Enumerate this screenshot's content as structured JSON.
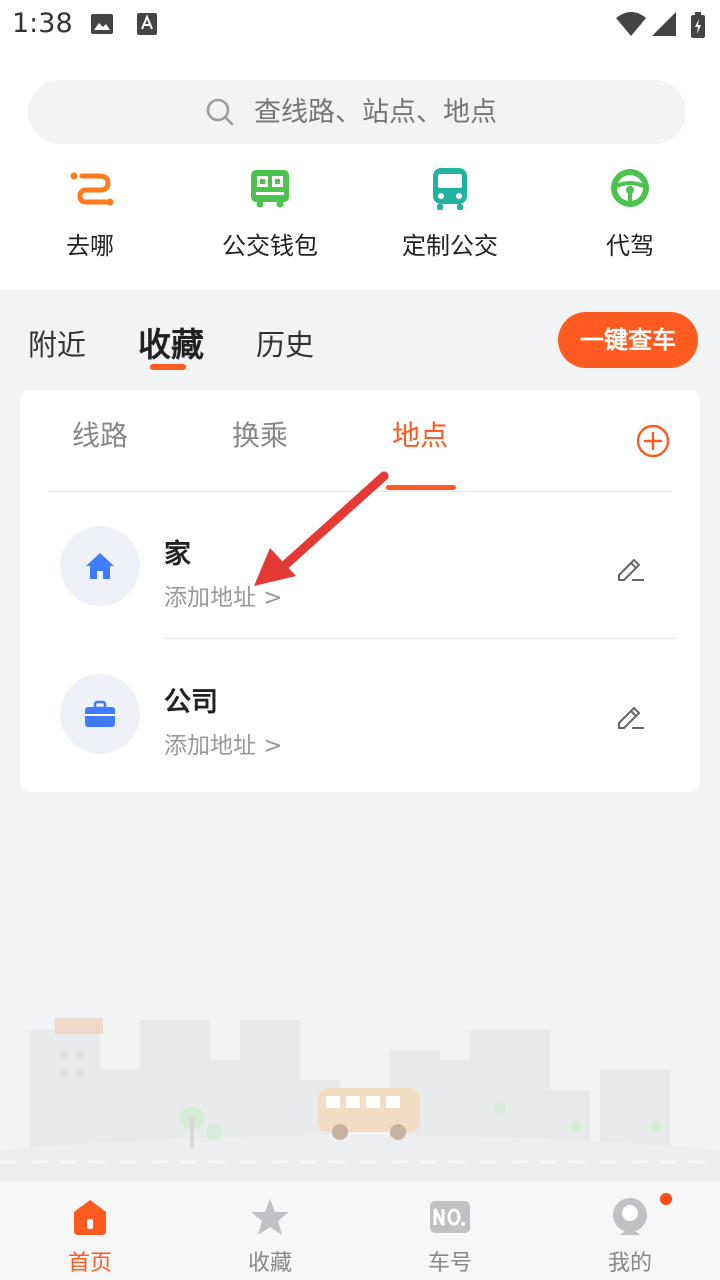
{
  "status": {
    "time": "1:38"
  },
  "search": {
    "placeholder": "查线路、站点、地点"
  },
  "shortcuts": [
    {
      "label": "去哪",
      "icon": "destination-icon"
    },
    {
      "label": "公交钱包",
      "icon": "bus-wallet-icon"
    },
    {
      "label": "定制公交",
      "icon": "custom-bus-icon"
    },
    {
      "label": "代驾",
      "icon": "steering-wheel-icon"
    }
  ],
  "main_tabs": {
    "nearby": "附近",
    "favorites": "收藏",
    "history": "历史",
    "active": "收藏"
  },
  "quick_check_button": "一键查车",
  "sub_tabs": {
    "routes": "线路",
    "transfer": "换乘",
    "places": "地点",
    "active": "地点"
  },
  "places": [
    {
      "name": "家",
      "action": "添加地址 >",
      "icon": "home-icon"
    },
    {
      "name": "公司",
      "action": "添加地址 >",
      "icon": "briefcase-icon"
    }
  ],
  "bottom_nav": [
    {
      "label": "首页",
      "icon": "home-nav-icon",
      "active": true
    },
    {
      "label": "收藏",
      "icon": "star-nav-icon",
      "active": false
    },
    {
      "label": "车号",
      "icon": "bus-number-nav-icon",
      "active": false
    },
    {
      "label": "我的",
      "icon": "profile-nav-icon",
      "active": false,
      "badge": true
    }
  ],
  "colors": {
    "accent": "#ff5a1f",
    "home_blue": "#3e7bff",
    "shortcut_orange": "#ff7a1a",
    "shortcut_green": "#4cc34c",
    "shortcut_teal": "#21b3a0",
    "annotation_arrow": "#e53935"
  }
}
